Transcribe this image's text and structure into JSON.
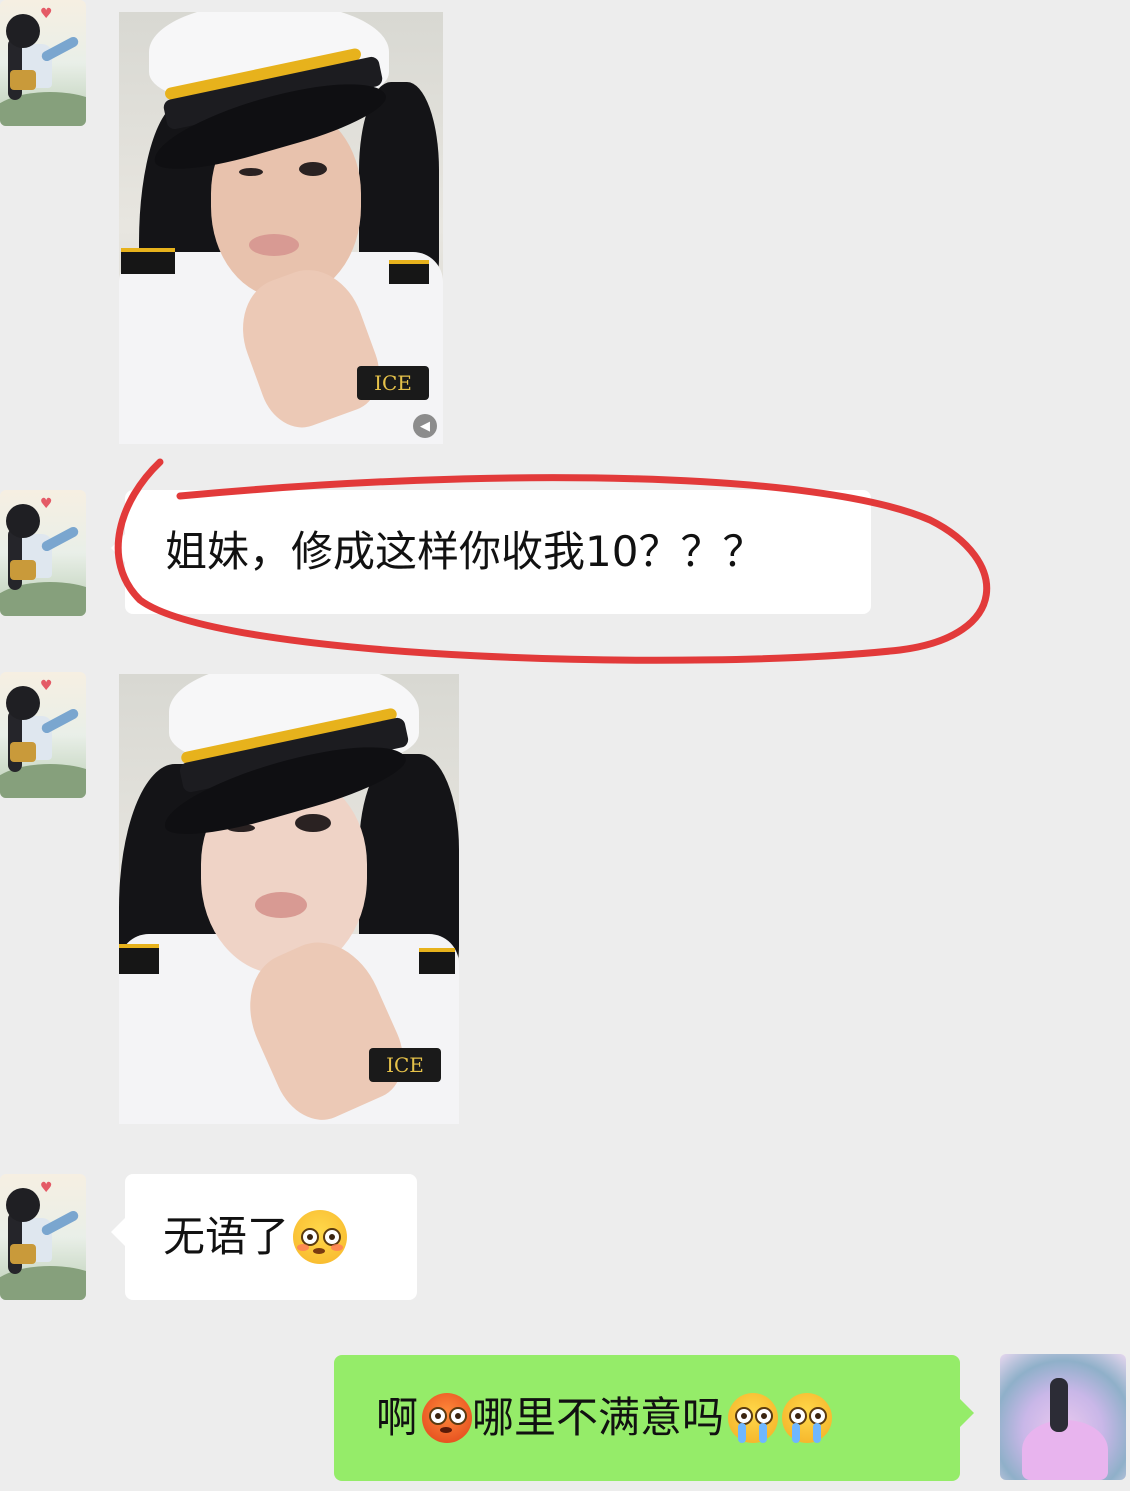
{
  "messages": [
    {
      "from": "left",
      "type": "image",
      "description_name": "photo-before-edit",
      "badge_text": "ICE"
    },
    {
      "from": "left",
      "type": "text",
      "text": "姐妹，修成这样你收我10？？？",
      "annotated": true
    },
    {
      "from": "left",
      "type": "image",
      "description_name": "photo-after-edit",
      "badge_text": "ICE"
    },
    {
      "from": "left",
      "type": "text",
      "text": "无语了",
      "emoji_after": [
        "flushed-face-emoji"
      ]
    },
    {
      "from": "right",
      "type": "text",
      "text_parts": [
        "啊",
        "哪里不满意吗"
      ],
      "emojis": [
        "angry-face-emoji",
        "crying-face-emoji",
        "crying-face-emoji"
      ]
    }
  ],
  "colors": {
    "background": "#ededed",
    "bubble_incoming": "#ffffff",
    "bubble_outgoing": "#95ec69",
    "annotation_circle": "#e23a3a"
  }
}
